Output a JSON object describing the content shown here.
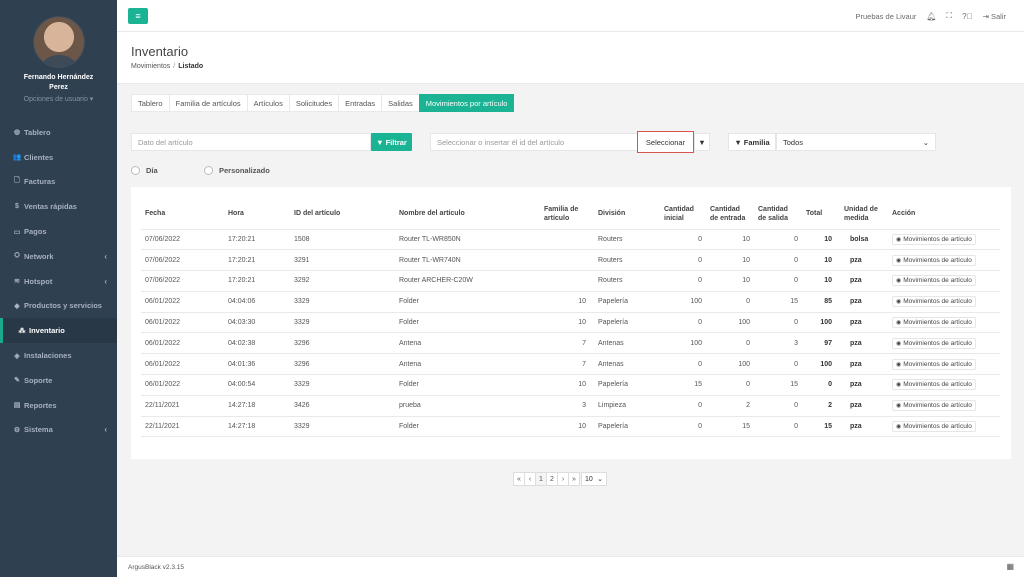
{
  "sidebar": {
    "profile_name": "Fernando Hernández Perez",
    "profile_options": "Opciones de usuario ▾",
    "items": [
      {
        "label": "Tablero",
        "icon": "dashboard-icon",
        "glyph": "◍"
      },
      {
        "label": "Clientes",
        "icon": "users-icon",
        "glyph": "👥"
      },
      {
        "label": "Facturas",
        "icon": "file-icon",
        "glyph": "🗋"
      },
      {
        "label": "Ventas rápidas",
        "icon": "dollar-icon",
        "glyph": "$"
      },
      {
        "label": "Pagos",
        "icon": "credit-card-icon",
        "glyph": "▭"
      },
      {
        "label": "Network",
        "icon": "network-icon",
        "glyph": "⛭"
      },
      {
        "label": "Hotspot",
        "icon": "wifi-icon",
        "glyph": "≋"
      },
      {
        "label": "Productos y servicios",
        "icon": "tag-icon",
        "glyph": "◆"
      },
      {
        "label": "Inventario",
        "icon": "cubes-icon",
        "glyph": "⁂"
      },
      {
        "label": "Instalaciones",
        "icon": "install-icon",
        "glyph": "◈"
      },
      {
        "label": "Soporte",
        "icon": "wrench-icon",
        "glyph": "✎"
      },
      {
        "label": "Reportes",
        "icon": "reports-icon",
        "glyph": "▤"
      },
      {
        "label": "Sistema",
        "icon": "gears-icon",
        "glyph": "⚙"
      }
    ]
  },
  "topbar": {
    "company": "Pruebas de Livaur",
    "logout": "Salir"
  },
  "heading": {
    "title": "Inventario",
    "crumb_1": "Movimientos",
    "crumb_sep": "/",
    "crumb_2": "Listado"
  },
  "tabs": [
    "Tablero",
    "Familia de artículos",
    "Artículos",
    "Solicitudes",
    "Entradas",
    "Salidas",
    "Movimientos por artículo"
  ],
  "filters": {
    "search_placeholder": "Dato del artículo",
    "filter_button": "Filtrar",
    "article_placeholder": "Seleccionar o insertar él id del artículo",
    "select_button": "Seleccionar",
    "family_label": "Familia",
    "family_value": "Todos",
    "radio_day": "Día",
    "radio_custom": "Personalizado"
  },
  "table": {
    "headers": [
      "Fecha",
      "Hora",
      "ID del artículo",
      "Nombre del artículo",
      "Familia de artículo",
      "División",
      "Cantidad inicial",
      "Cantidad de entrada",
      "Cantidad de salida",
      "Total",
      "Unidad de medida",
      "Acción"
    ],
    "action_label": "Movimientos de artículo",
    "rows": [
      [
        "07/06/2022",
        "17:20:21",
        "1508",
        "Router TL-WR850N",
        "",
        "Routers",
        "0",
        "10",
        "0",
        "10",
        "bolsa"
      ],
      [
        "07/06/2022",
        "17:20:21",
        "3291",
        "Router TL-WR740N",
        "",
        "Routers",
        "0",
        "10",
        "0",
        "10",
        "pza"
      ],
      [
        "07/06/2022",
        "17:20:21",
        "3292",
        "Router ARCHER-C20W",
        "",
        "Routers",
        "0",
        "10",
        "0",
        "10",
        "pza"
      ],
      [
        "06/01/2022",
        "04:04:06",
        "3329",
        "Folder",
        "10",
        "Papelería",
        "100",
        "0",
        "15",
        "85",
        "pza"
      ],
      [
        "06/01/2022",
        "04:03:30",
        "3329",
        "Folder",
        "10",
        "Papelería",
        "0",
        "100",
        "0",
        "100",
        "pza"
      ],
      [
        "06/01/2022",
        "04:02:38",
        "3296",
        "Antena",
        "7",
        "Antenas",
        "100",
        "0",
        "3",
        "97",
        "pza"
      ],
      [
        "06/01/2022",
        "04:01:36",
        "3296",
        "Antena",
        "7",
        "Antenas",
        "0",
        "100",
        "0",
        "100",
        "pza"
      ],
      [
        "06/01/2022",
        "04:00:54",
        "3329",
        "Folder",
        "10",
        "Papelería",
        "15",
        "0",
        "15",
        "0",
        "pza"
      ],
      [
        "22/11/2021",
        "14:27:18",
        "3426",
        "prueba",
        "3",
        "Limpieza",
        "0",
        "2",
        "0",
        "2",
        "pza"
      ],
      [
        "22/11/2021",
        "14:27:18",
        "3329",
        "Folder",
        "10",
        "Papelería",
        "0",
        "15",
        "0",
        "15",
        "pza"
      ]
    ]
  },
  "pagination": {
    "first": "«",
    "prev": "‹",
    "pages": [
      "1",
      "2"
    ],
    "next": "›",
    "last": "»",
    "page_size": "10"
  },
  "footer": {
    "version": "ArgusBlack v2.3.15"
  },
  "colors": {
    "sidebar": "#2f4050",
    "accent": "#1ab394",
    "highlight_border": "#d9534f"
  }
}
